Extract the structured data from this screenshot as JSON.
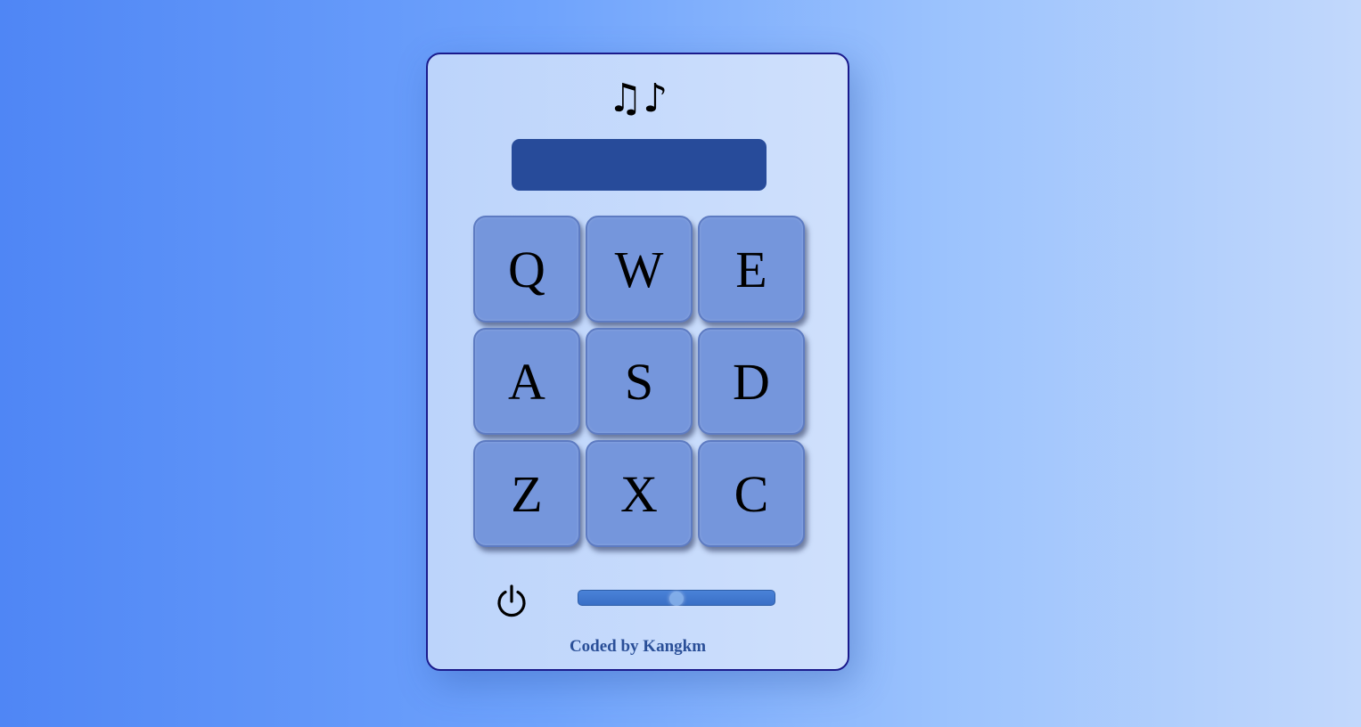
{
  "header": {
    "icon": "music-notes-icon",
    "glyph": "♫♪"
  },
  "display": {
    "text": ""
  },
  "keys": [
    "Q",
    "W",
    "E",
    "A",
    "S",
    "D",
    "Z",
    "X",
    "C"
  ],
  "controls": {
    "power_icon": "power-icon",
    "volume_fraction": 0.5
  },
  "footer": {
    "credit": "Coded by Kangkm"
  },
  "colors": {
    "display": "#274b9a",
    "key": "#7596dc",
    "credit": "#2a4f98",
    "panel_border": "#1a1a8c"
  }
}
